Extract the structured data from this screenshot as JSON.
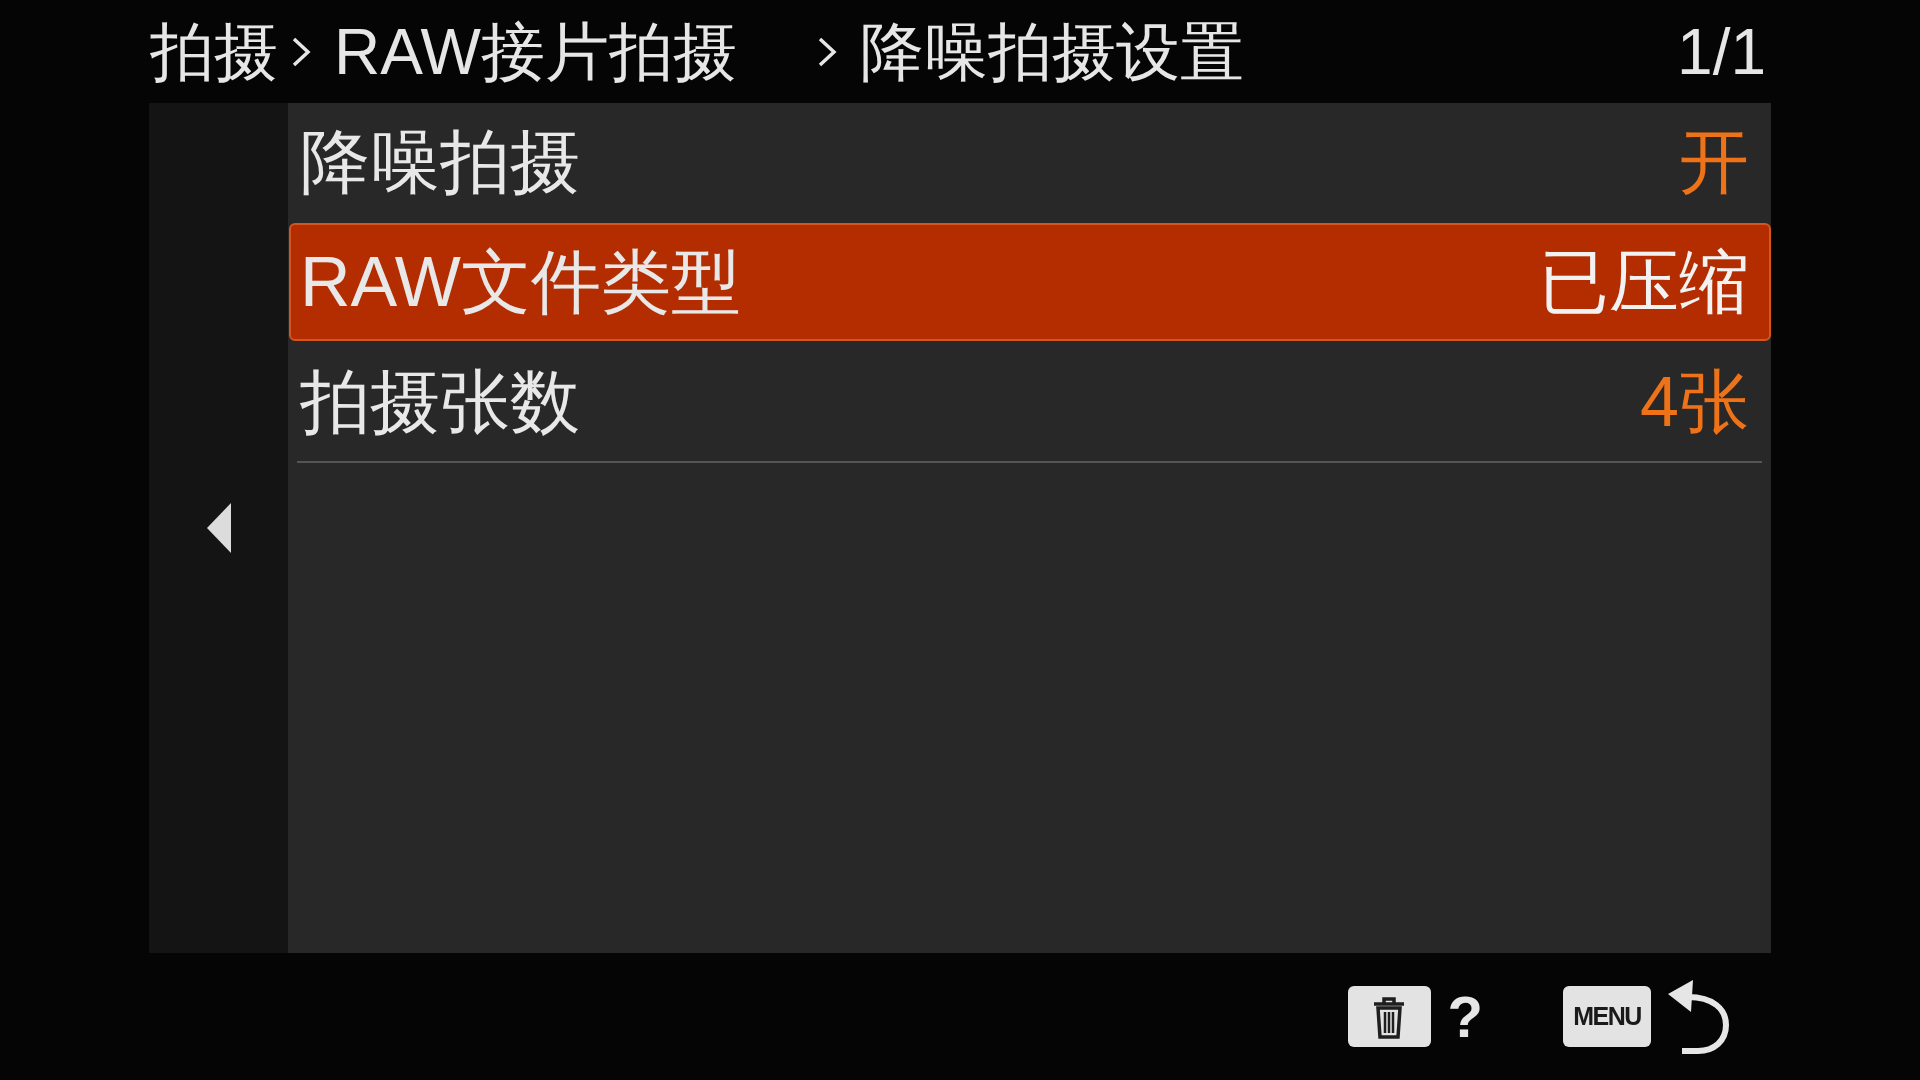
{
  "header": {
    "breadcrumb": [
      "拍摄",
      "RAW接片拍摄",
      "降噪拍摄设置"
    ],
    "page": "1/1"
  },
  "menu": {
    "items": [
      {
        "label": "降噪拍摄",
        "value": "开",
        "selected": false
      },
      {
        "label": "RAW文件类型",
        "value": "已压缩",
        "selected": true
      },
      {
        "label": "拍摄张数",
        "value": "4张",
        "selected": false
      }
    ]
  },
  "footer": {
    "help": "?",
    "menu_key": "MENU"
  }
}
